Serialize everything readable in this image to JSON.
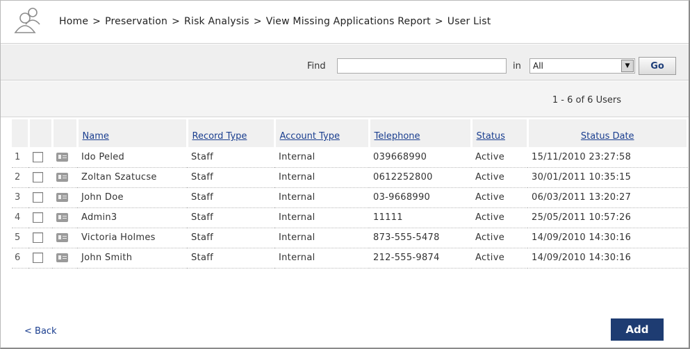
{
  "breadcrumb": {
    "items": [
      "Home",
      "Preservation",
      "Risk Analysis",
      "View Missing Applications Report",
      "User List"
    ],
    "separator": ">"
  },
  "search": {
    "find_label": "Find",
    "find_value": "",
    "in_label": "in",
    "scope_selected": "All",
    "go_label": "Go"
  },
  "pagination": {
    "summary": "1 - 6 of 6 Users"
  },
  "table": {
    "columns": [
      "Name",
      "Record Type",
      "Account Type",
      "Telephone",
      "Status",
      "Status Date"
    ],
    "rows": [
      {
        "index": "1",
        "name": "Ido Peled",
        "record_type": "Staff",
        "account_type": "Internal",
        "telephone": "039668990",
        "status": "Active",
        "status_date": "15/11/2010 23:27:58"
      },
      {
        "index": "2",
        "name": "Zoltan Szatucse",
        "record_type": "Staff",
        "account_type": "Internal",
        "telephone": "0612252800",
        "status": "Active",
        "status_date": "30/01/2011 10:35:15"
      },
      {
        "index": "3",
        "name": "John Doe",
        "record_type": "Staff",
        "account_type": "Internal",
        "telephone": "03-9668990",
        "status": "Active",
        "status_date": "06/03/2011 13:20:27"
      },
      {
        "index": "4",
        "name": "Admin3",
        "record_type": "Staff",
        "account_type": "Internal",
        "telephone": "11111",
        "status": "Active",
        "status_date": "25/05/2011 10:57:26"
      },
      {
        "index": "5",
        "name": "Victoria Holmes",
        "record_type": "Staff",
        "account_type": "Internal",
        "telephone": "873-555-5478",
        "status": "Active",
        "status_date": "14/09/2010 14:30:16"
      },
      {
        "index": "6",
        "name": "John Smith",
        "record_type": "Staff",
        "account_type": "Internal",
        "telephone": "212-555-9874",
        "status": "Active",
        "status_date": "14/09/2010 14:30:16"
      }
    ]
  },
  "footer": {
    "back_label": "< Back",
    "add_label": "Add"
  },
  "colors": {
    "link": "#1a3e8f",
    "add_button": "#1e3c72",
    "go_text": "#1f3f7a"
  },
  "icons": {
    "header": "users-icon",
    "row_card": "contact-card-icon",
    "dropdown": "chevron-down-icon"
  }
}
